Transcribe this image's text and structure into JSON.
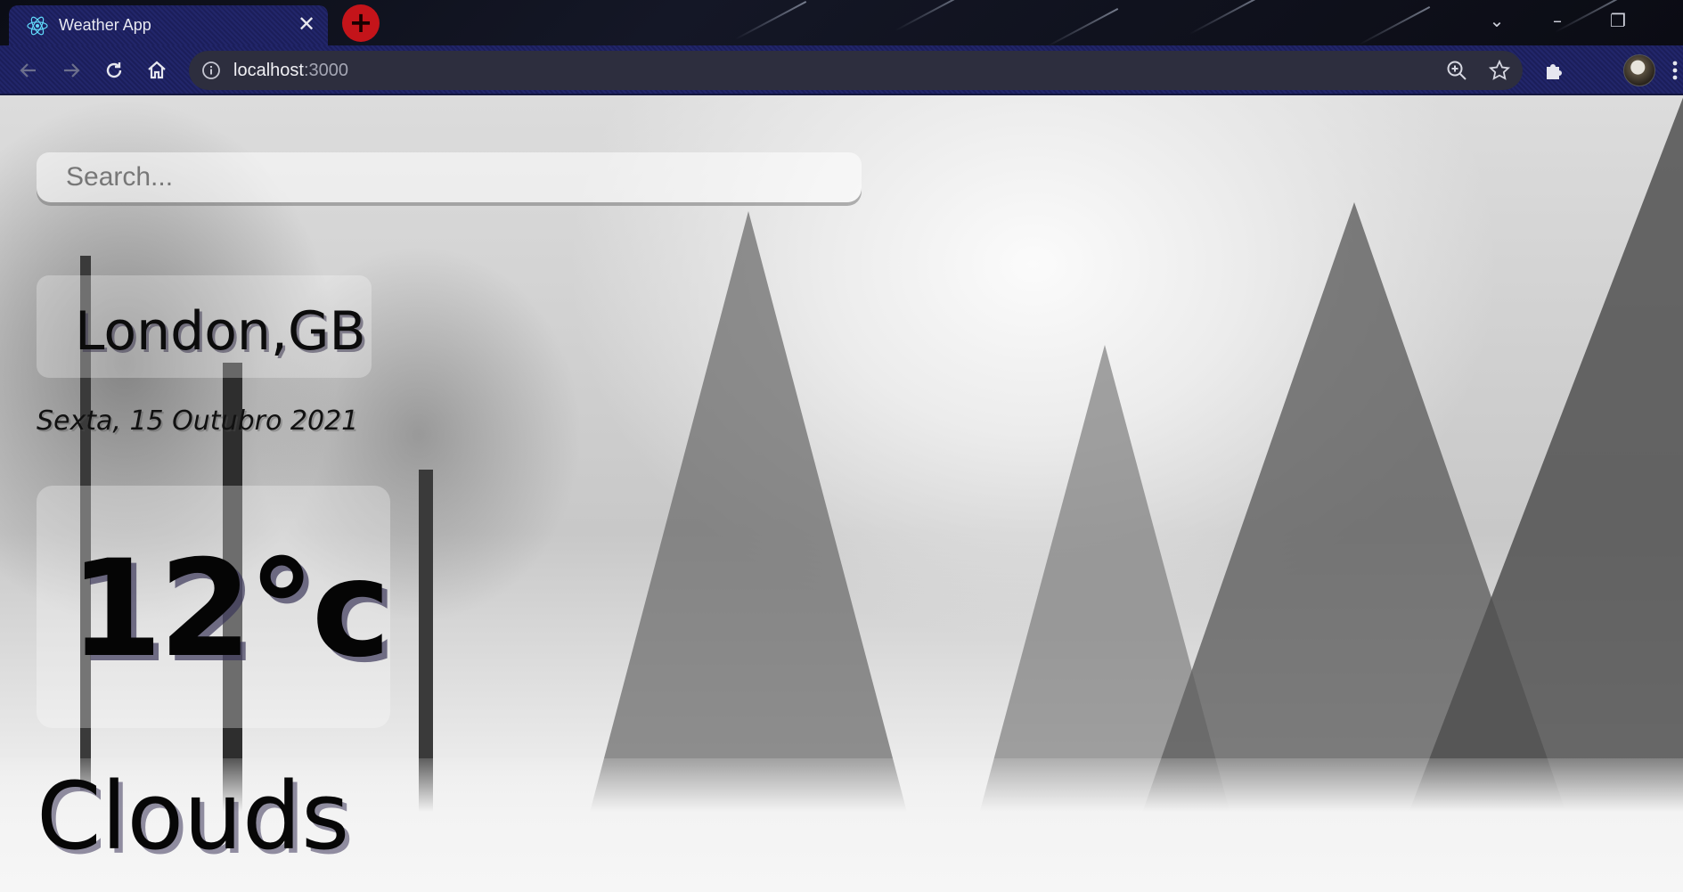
{
  "browser": {
    "tab": {
      "title": "Weather App",
      "icon": "react-icon",
      "close": "✕"
    },
    "new_tab": "+",
    "window_controls": {
      "minimize": "–",
      "restore": "❐",
      "dropdown": "⌄"
    },
    "address_bar": {
      "host": "localhost",
      "port": ":3000"
    }
  },
  "page": {
    "search": {
      "placeholder": "Search...",
      "value": ""
    },
    "location": "London,GB",
    "date": "Sexta, 15 Outubro 2021",
    "temperature": "12°c",
    "condition": "Clouds"
  },
  "colors": {
    "tab_bg": "#22266a",
    "new_tab_button": "#c4141a",
    "omnibox_bg": "#2d2e3e"
  }
}
